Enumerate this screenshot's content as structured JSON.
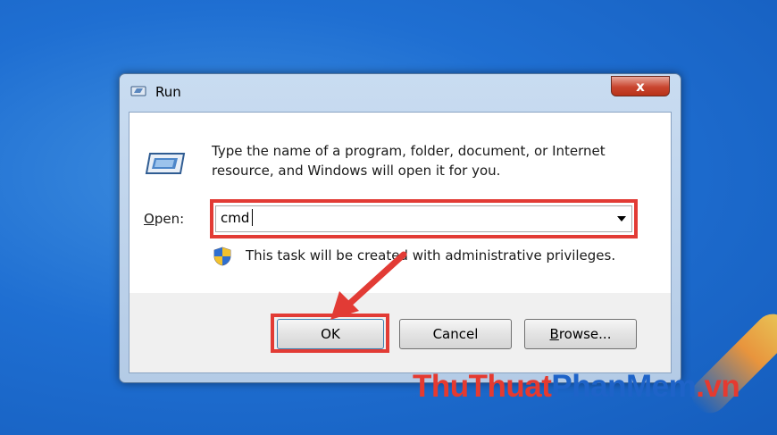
{
  "window": {
    "title": "Run",
    "close_label": "x"
  },
  "dialog": {
    "description": "Type the name of a program, folder, document, or Internet resource, and Windows will open it for you.",
    "open_label_underlined": "O",
    "open_label_rest": "pen:",
    "open_value": "cmd",
    "admin_text": "This task will be created with administrative privileges."
  },
  "buttons": {
    "ok": "OK",
    "cancel": "Cancel",
    "browse_underlined": "B",
    "browse_rest": "rowse..."
  },
  "watermark": {
    "part1": "ThuThuat",
    "part2": "PhanMem",
    "part3": ".vn"
  },
  "colors": {
    "highlight": "#e23b35",
    "desktop": "#1f6fd2",
    "watermark_red": "#e53a30",
    "watermark_blue": "#1e63c8"
  },
  "icons": {
    "title": "run-icon",
    "main": "run-icon",
    "shield": "uac-shield-icon",
    "arrow": "red-pointer-arrow-icon"
  }
}
